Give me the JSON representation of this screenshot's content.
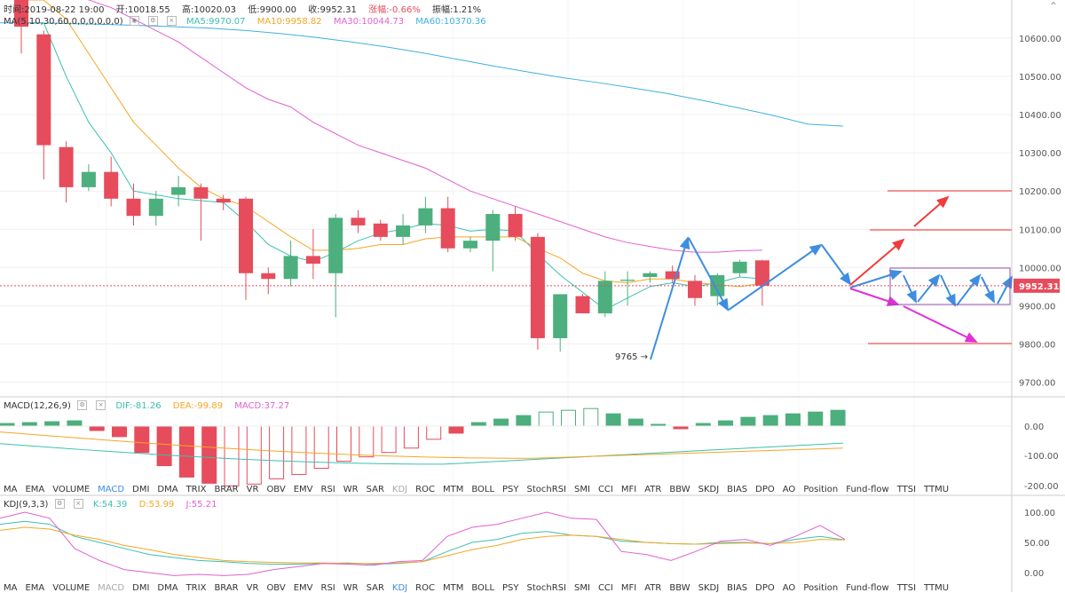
{
  "header": {
    "time_label": "时间:2019-08-22 19:00",
    "open_label": "开:10018.55",
    "high_label": "高:10020.03",
    "low_label": "低:9900.00",
    "close_label": "收:9952.31",
    "change_label": "涨幅:-0.66%",
    "amplitude_label": "振幅:1.21%"
  },
  "ma_legend": {
    "params": "MA(5,10,30,60,0,0,0,0,0,0)",
    "ma5": "MA5:9970.07",
    "ma10": "MA10:9958.82",
    "ma30": "MA30:10044.73",
    "ma60": "MA60:10370.36"
  },
  "macd_legend": {
    "params": "MACD(12,26,9)",
    "dif": "DIF:-81.26",
    "dea": "DEA:-99.89",
    "macd": "MACD:37.27"
  },
  "kdj_legend": {
    "params": "KDJ(9,3,3)",
    "k": "K:54.39",
    "d": "D:53.99",
    "j": "J:55.21"
  },
  "indicators": [
    "MA",
    "EMA",
    "VOLUME",
    "MACD",
    "DMI",
    "DMA",
    "TRIX",
    "BRAR",
    "VR",
    "OBV",
    "EMV",
    "RSI",
    "WR",
    "SAR",
    "KDJ",
    "ROC",
    "MTM",
    "BOLL",
    "PSY",
    "StochRSI",
    "SMI",
    "CCI",
    "MFI",
    "ATR",
    "BBW",
    "SKDJ",
    "BIAS",
    "DPO",
    "AO",
    "Position",
    "Fund-flow",
    "TTSI",
    "TTMU"
  ],
  "indicator_bar_1_active": "MACD",
  "indicator_bar_1_dim": "KDJ",
  "indicator_bar_2_active": "KDJ",
  "indicator_bar_2_dim": "MACD",
  "price_axis": [
    "10600.00",
    "10500.00",
    "10400.00",
    "10300.00",
    "10200.00",
    "10100.00",
    "10000.00",
    "9900.00",
    "9800.00",
    "9700.00"
  ],
  "macd_axis": [
    "0.00",
    "-100.00",
    "-200.00"
  ],
  "kdj_axis": [
    "100.00",
    "50.00",
    "0.00"
  ],
  "current_price_tag": "9952.31",
  "low_annotation": "9765",
  "colors": {
    "up": "#4caf7d",
    "down": "#e64c5c",
    "ma5": "#3cc0b0",
    "ma10": "#f5a623",
    "ma30": "#e060d0",
    "ma60": "#40b0e0",
    "arrow_blue": "#3d8ee0",
    "arrow_red": "#f03c3c",
    "arrow_magenta": "#e030d8",
    "box_purple": "#9050b0"
  },
  "chart_data": {
    "type": "candlestick",
    "candles": [
      {
        "o": 10700,
        "h": 10720,
        "l": 10560,
        "c": 10630
      },
      {
        "o": 10610,
        "h": 10620,
        "l": 10230,
        "c": 10320
      },
      {
        "o": 10315,
        "h": 10330,
        "l": 10170,
        "c": 10210
      },
      {
        "o": 10210,
        "h": 10270,
        "l": 10200,
        "c": 10250
      },
      {
        "o": 10250,
        "h": 10290,
        "l": 10160,
        "c": 10180
      },
      {
        "o": 10180,
        "h": 10220,
        "l": 10110,
        "c": 10135
      },
      {
        "o": 10135,
        "h": 10200,
        "l": 10110,
        "c": 10180
      },
      {
        "o": 10190,
        "h": 10240,
        "l": 10160,
        "c": 10210
      },
      {
        "o": 10210,
        "h": 10220,
        "l": 10070,
        "c": 10180
      },
      {
        "o": 10180,
        "h": 10190,
        "l": 10150,
        "c": 10170
      },
      {
        "o": 10180,
        "h": 10185,
        "l": 9915,
        "c": 9985
      },
      {
        "o": 9985,
        "h": 10000,
        "l": 9930,
        "c": 9970
      },
      {
        "o": 9970,
        "h": 10070,
        "l": 9950,
        "c": 10030
      },
      {
        "o": 10030,
        "h": 10100,
        "l": 9970,
        "c": 10010
      },
      {
        "o": 9985,
        "h": 10140,
        "l": 9870,
        "c": 10130
      },
      {
        "o": 10130,
        "h": 10150,
        "l": 10090,
        "c": 10110
      },
      {
        "o": 10115,
        "h": 10125,
        "l": 10070,
        "c": 10080
      },
      {
        "o": 10080,
        "h": 10140,
        "l": 10060,
        "c": 10110
      },
      {
        "o": 10110,
        "h": 10185,
        "l": 10090,
        "c": 10155
      },
      {
        "o": 10155,
        "h": 10185,
        "l": 10040,
        "c": 10050
      },
      {
        "o": 10050,
        "h": 10080,
        "l": 10040,
        "c": 10070
      },
      {
        "o": 10070,
        "h": 10150,
        "l": 9990,
        "c": 10140
      },
      {
        "o": 10140,
        "h": 10160,
        "l": 10070,
        "c": 10080
      },
      {
        "o": 10080,
        "h": 10090,
        "l": 9785,
        "c": 9815
      },
      {
        "o": 9815,
        "h": 9930,
        "l": 9780,
        "c": 9930
      },
      {
        "o": 9925,
        "h": 9930,
        "l": 9900,
        "c": 9880
      },
      {
        "o": 9880,
        "h": 9990,
        "l": 9870,
        "c": 9965
      },
      {
        "o": 9965,
        "h": 9990,
        "l": 9900,
        "c": 9968
      },
      {
        "o": 9975,
        "h": 9990,
        "l": 9960,
        "c": 9985
      },
      {
        "o": 9990,
        "h": 10005,
        "l": 9960,
        "c": 9970
      },
      {
        "o": 9965,
        "h": 9980,
        "l": 9900,
        "c": 9920
      },
      {
        "o": 9925,
        "h": 9985,
        "l": 9900,
        "c": 9980
      },
      {
        "o": 9985,
        "h": 10020,
        "l": 9975,
        "c": 10015
      },
      {
        "o": 10018.55,
        "h": 10020.03,
        "l": 9900,
        "c": 9952.31
      }
    ],
    "ma5": [
      10640,
      10640,
      10500,
      10380,
      10300,
      10200,
      10190,
      10180,
      10175,
      10170,
      10120,
      10060,
      10030,
      10015,
      10040,
      10070,
      10090,
      10100,
      10115,
      10110,
      10095,
      10100,
      10095,
      10035,
      9980,
      9935,
      9890,
      9920,
      9950,
      9960,
      9950,
      9960,
      9975,
      9970
    ],
    "ma10": [
      10700,
      10700,
      10650,
      10560,
      10470,
      10380,
      10320,
      10260,
      10210,
      10180,
      10160,
      10120,
      10080,
      10045,
      10045,
      10050,
      10060,
      10060,
      10075,
      10080,
      10080,
      10080,
      10080,
      10050,
      10025,
      9985,
      9965,
      9960,
      9970,
      9970,
      9960,
      9955,
      9950,
      9959
    ],
    "ma30": [
      10750,
      10740,
      10720,
      10700,
      10680,
      10650,
      10620,
      10590,
      10550,
      10510,
      10470,
      10440,
      10420,
      10380,
      10350,
      10320,
      10300,
      10280,
      10260,
      10230,
      10200,
      10180,
      10160,
      10140,
      10120,
      10100,
      10080,
      10065,
      10055,
      10045,
      10040,
      10040,
      10044,
      10045
    ],
    "ma60": [
      10640,
      10640,
      10638,
      10636,
      10633,
      10630,
      10626,
      10620,
      10612,
      10602,
      10590,
      10577,
      10562,
      10545,
      10528,
      10512,
      10497,
      10484,
      10470,
      10455,
      10437,
      10418,
      10398,
      10375,
      10370
    ]
  }
}
